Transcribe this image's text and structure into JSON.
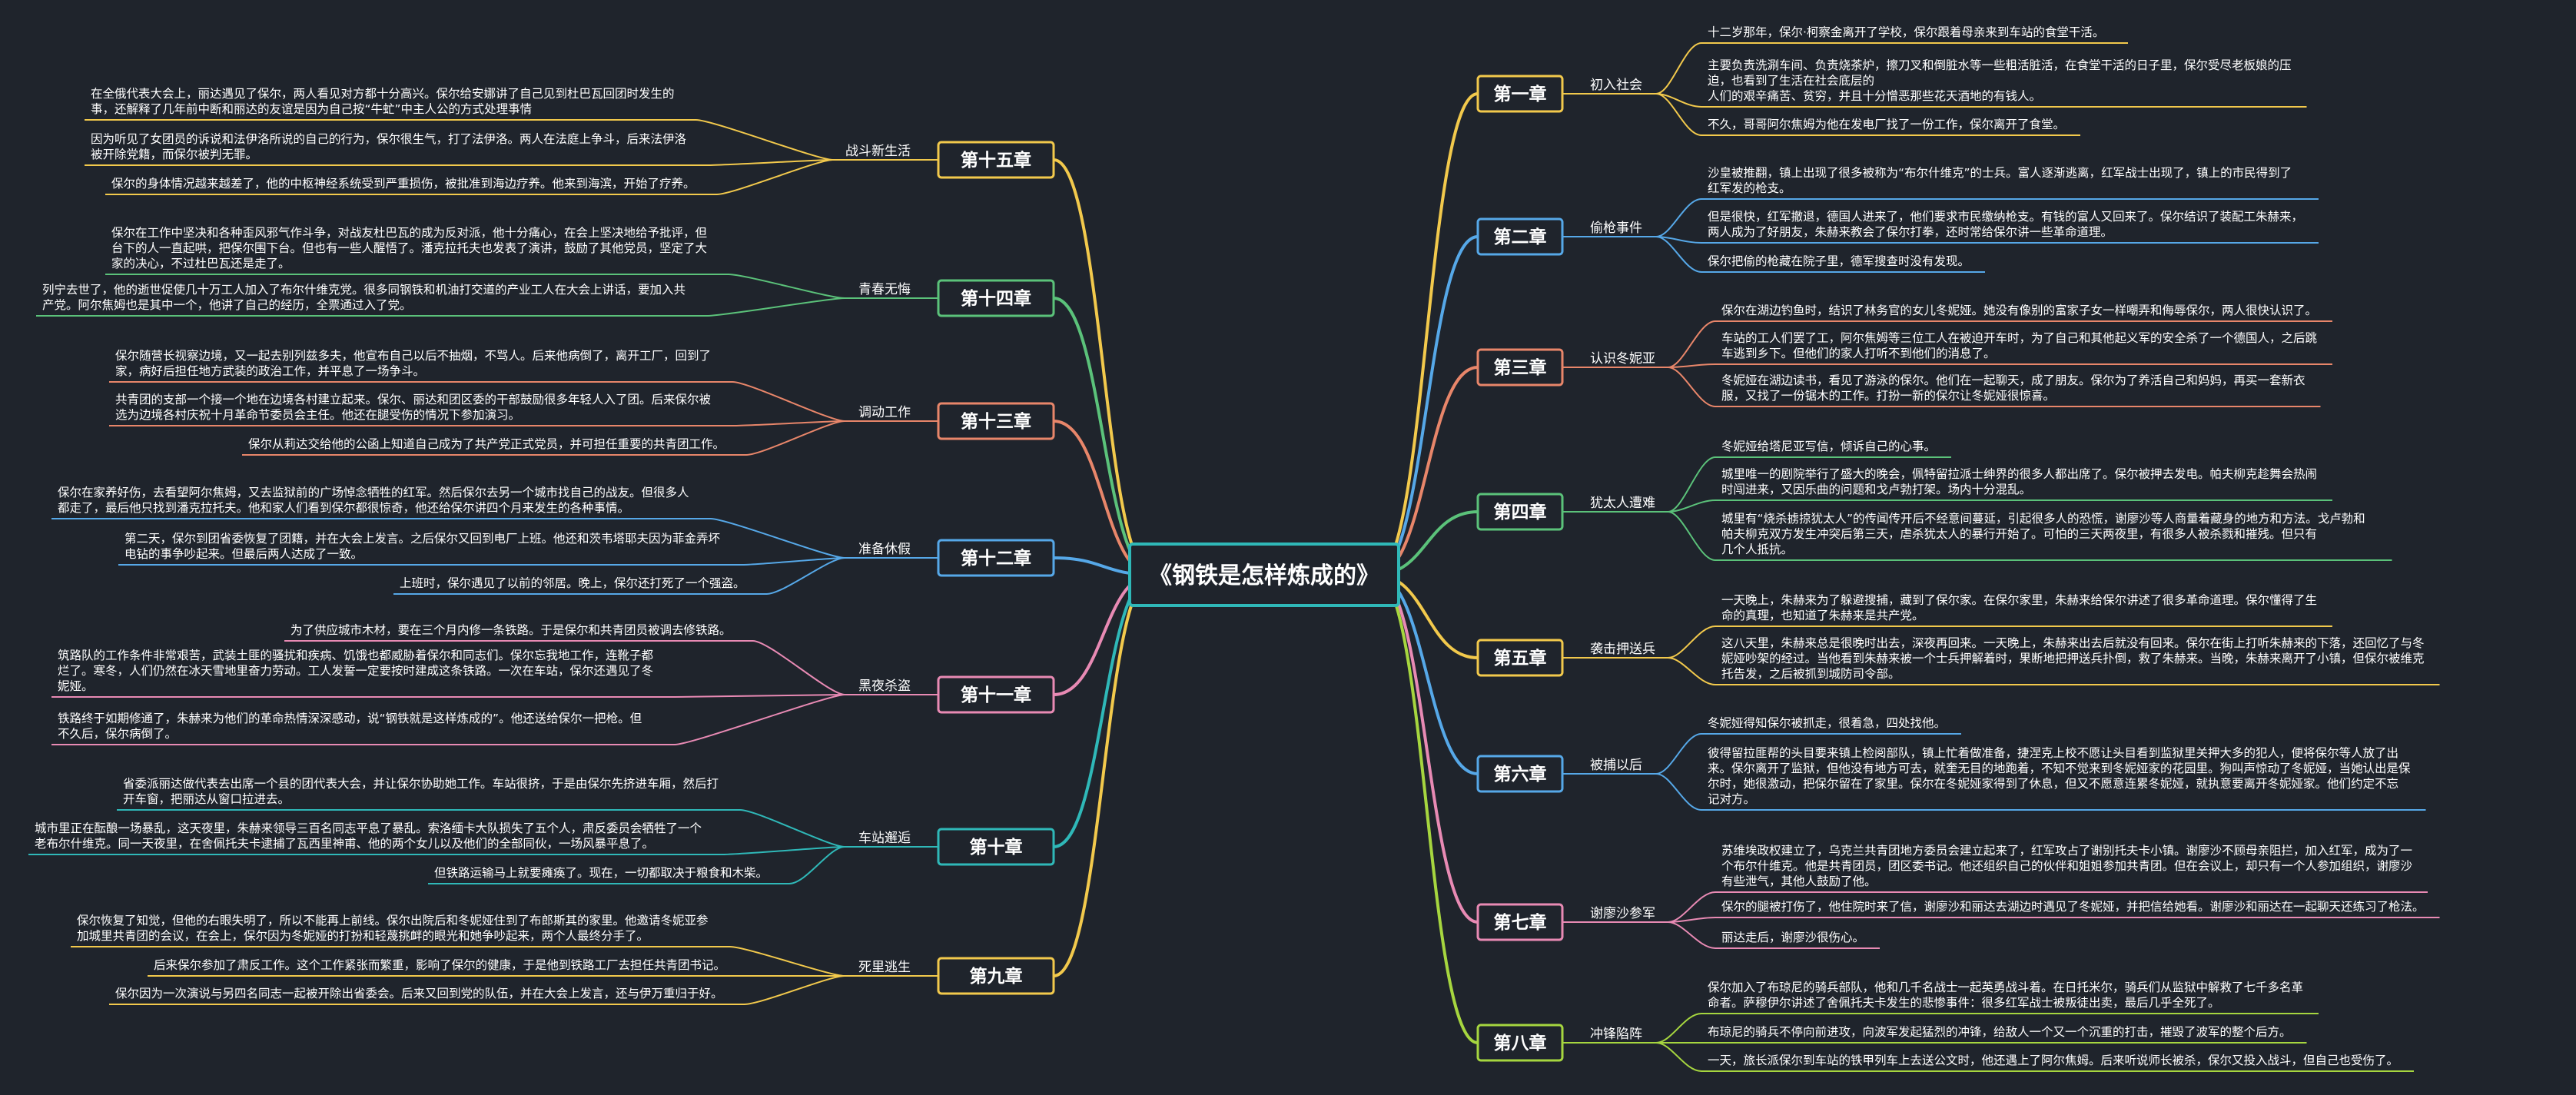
{
  "root": {
    "title": "《钢铁是怎样炼成的》",
    "color": "#2fb8b8"
  },
  "chapters": [
    {
      "label": "第一章",
      "sub": "初入社会",
      "color": "#f2c94c",
      "side": "right",
      "leaves": [
        [
          "十二岁那年，保尔·柯察金离开了学校，保尔跟着母亲来到车站的食堂干活。"
        ],
        [
          "主要负责洗涮车间、负责烧茶炉，擦刀叉和倒脏水等一些粗活脏活，在食堂干活的日子里，保尔受尽老板娘的压",
          "迫，也看到了生活在社会底层的",
          "人们的艰辛痛苦、贫穷，并且十分憎恶那些花天酒地的有钱人。"
        ],
        [
          "不久，哥哥阿尔焦姆为他在发电厂找了一份工作，保尔离开了食堂。"
        ]
      ]
    },
    {
      "label": "第二章",
      "sub": "偷枪事件",
      "color": "#56a8e8",
      "side": "right",
      "leaves": [
        [
          "沙皇被推翻，镇上出现了很多被称为“布尔什维克”的士兵。富人逐渐逃离，红军战士出现了，镇上的市民得到了",
          "红军发的枪支。"
        ],
        [
          "但是很快，红军撤退，德国人进来了，他们要求市民缴纳枪支。有钱的富人又回来了。保尔结识了装配工朱赫来，",
          "两人成为了好朋友，朱赫来教会了保尔打拳，还时常给保尔讲一些革命道理。"
        ],
        [
          "保尔把偷的枪藏在院子里，德军搜查时没有发现。"
        ]
      ]
    },
    {
      "label": "第三章",
      "sub": "认识冬妮亚",
      "color": "#e8866a",
      "side": "right",
      "leaves": [
        [
          "保尔在湖边钓鱼时，结识了林务官的女儿冬妮娅。她没有像别的富家子女一样嘲弄和侮辱保尔，两人很快认识了。"
        ],
        [
          "车站的工人们罢了工，阿尔焦姆等三位工人在被迫开车时，为了自己和其他起义军的安全杀了一个德国人，之后跳",
          "车逃到乡下。但他们的家人打听不到他们的消息了。"
        ],
        [
          "冬妮娅在湖边读书，看见了游泳的保尔。他们在一起聊天，成了朋友。保尔为了养活自己和妈妈，再买一套新衣",
          "服，又找了一份锯木的工作。打扮一新的保尔让冬妮娅很惊喜。"
        ]
      ]
    },
    {
      "label": "第四章",
      "sub": "犹太人遭难",
      "color": "#5bc27a",
      "side": "right",
      "leaves": [
        [
          "冬妮娅给塔尼亚写信，倾诉自己的心事。"
        ],
        [
          "城里唯一的剧院举行了盛大的晚会，佩特留拉派士绅界的很多人都出席了。保尔被押去发电。帕夫柳克趁舞会热闹",
          "时闯进来，又因乐曲的问题和戈卢勃打架。场内十分混乱。"
        ],
        [
          "城里有“烧杀掳掠犹太人”的传闻传开后不经意间蔓延，引起很多人的恐慌，谢廖沙等人商量着藏身的地方和方法。戈卢勃和",
          "帕夫柳克双方发生冲突后第三天，虐杀犹太人的暴行开始了。可怕的三天两夜里，有很多人被杀戮和摧残。但只有",
          "几个人抵抗。"
        ]
      ]
    },
    {
      "label": "第五章",
      "sub": "袭击押送兵",
      "color": "#f2c94c",
      "side": "right",
      "leaves": [
        [
          "一天晚上，朱赫来为了躲避搜捕，藏到了保尔家。在保尔家里，朱赫来给保尔讲述了很多革命道理。保尔懂得了生",
          "命的真理，也知道了朱赫来是共产党。"
        ],
        [
          "这八天里，朱赫来总是很晚时出去，深夜再回来。一天晚上，朱赫来出去后就没有回来。保尔在街上打听朱赫来的下落，还回忆了与冬",
          "妮娅吵架的经过。当他看到朱赫来被一个士兵押解着时，果断地把押送兵扑倒，救了朱赫来。当晚，朱赫来离开了小镇，但保尔被维克",
          "托告发，之后被抓到城防司令部。"
        ]
      ]
    },
    {
      "label": "第六章",
      "sub": "被捕以后",
      "color": "#56a8e8",
      "side": "right",
      "leaves": [
        [
          "冬妮娅得知保尔被抓走，很着急，四处找他。"
        ],
        [
          "彼得留拉匪帮的头目要来镇上检阅部队，镇上忙着做准备，捷涅克上校不愿让头目看到监狱里关押大多的犯人，便将保尔等人放了出",
          "来。保尔离开了监狱，但他没有地方可去，就奎无目的地跑着，不知不觉来到冬妮娅家的花园里。狗叫声惊动了冬妮娅，当她认出是保",
          "尔时，她很激动，把保尔留在了家里。保尔在冬妮娅家得到了休息，但又不愿意连累冬妮娅，就执意要离开冬妮娅家。他们约定不忘",
          "记对方。"
        ]
      ]
    },
    {
      "label": "第七章",
      "sub": "谢廖沙参军",
      "color": "#e88ab4",
      "side": "right",
      "leaves": [
        [
          "苏维埃政权建立了，乌克兰共青团地方委员会建立起来了，红军攻占了谢别托夫卡小镇。谢廖沙不顾母亲阻拦，加入红军，成为了一",
          "个布尔什维克。他是共青团员，团区委书记。他还组织自己的伙伴和姐姐参加共青团。但在会议上，却只有一个人参加组织，谢廖沙",
          "有些泄气，其他人鼓励了他。"
        ],
        [
          "保尔的腿被打伤了，他住院时来了信，谢廖沙和丽达去湖边时遇见了冬妮娅，并把信给她看。谢廖沙和丽达在一起聊天还练习了枪法。"
        ],
        [
          "丽达走后，谢廖沙很伤心。"
        ]
      ]
    },
    {
      "label": "第八章",
      "sub": "冲锋陷阵",
      "color": "#a6d63f",
      "side": "right",
      "leaves": [
        [
          "保尔加入了布琼尼的骑兵部队，他和几千名战士一起英勇战斗着。在日托米尔，骑兵们从监狱中解救了七千多名革",
          "命者。萨穆伊尔讲述了舍佩托夫卡发生的悲惨事件：很多红军战士被叛徒出卖，最后几乎全死了。"
        ],
        [
          "布琼尼的骑兵不停向前进攻，向波军发起猛烈的冲锋，给敌人一个又一个沉重的打击，摧毁了波军的整个后方。"
        ],
        [
          "一天，旅长派保尔到车站的铁甲列车上去送公文时，他还遇上了阿尔焦姆。后来听说师长被杀，保尔又投入战斗，但自己也受伤了。"
        ]
      ]
    },
    {
      "label": "第十五章",
      "sub": "战斗新生活",
      "color": "#f2c94c",
      "side": "left",
      "leaves": [
        [
          "在全俄代表大会上，丽达遇见了保尔，两人看见对方都十分高兴。保尔给安娜讲了自己见到杜巴瓦回团时发生的",
          "事，还解释了几年前中断和丽达的友谊是因为自己按“牛虻”中主人公的方式处理事情"
        ],
        [
          "因为听见了女团员的诉说和法伊洛所说的自己的行为，保尔很生气，打了法伊洛。两人在法庭上争斗，后来法伊洛",
          "被开除党籍，而保尔被判无罪。"
        ],
        [
          "保尔的身体情况越来越差了，他的中枢神经系统受到严重损伤，被批准到海边疗养。他来到海滨，开始了疗养。"
        ]
      ]
    },
    {
      "label": "第十四章",
      "sub": "青春无悔",
      "color": "#5bc27a",
      "side": "left",
      "leaves": [
        [
          "保尔在工作中坚决和各种歪风邪气作斗争，对战友杜巴瓦的成为反对派，他十分痛心，在会上坚决地给予批评，但",
          "台下的人一直起哄，把保尔围下台。但也有一些人醒悟了。潘克拉托夫也发表了演讲，鼓励了其他党员，坚定了大",
          "家的决心，不过杜巴瓦还是走了。"
        ],
        [
          "列宁去世了，他的逝世促使几十万工人加入了布尔什维克党。很多同钢铁和机油打交道的产业工人在大会上讲话，要加入共",
          "产党。阿尔焦姆也是其中一个，他讲了自己的经历，全票通过入了党。"
        ]
      ]
    },
    {
      "label": "第十三章",
      "sub": "调动工作",
      "color": "#e8866a",
      "side": "left",
      "leaves": [
        [
          "保尔随营长视察边境，又一起去别列兹多夫，他宣布自己以后不抽烟，不骂人。后来他病倒了，离开工厂，回到了",
          "家，病好后担任地方武装的政治工作，并平息了一场争斗。"
        ],
        [
          "共青团的支部一个接一个地在边境各村建立起来。保尔、丽达和团区委的干部鼓励很多年轻人入了团。后来保尔被",
          "选为边境各村庆祝十月革命节委员会主任。他还在腿受伤的情况下参加演习。"
        ],
        [
          "保尔从莉达交给他的公函上知道自己成为了共产党正式党员，并可担任重要的共青团工作。"
        ]
      ]
    },
    {
      "label": "第十二章",
      "sub": "准备休假",
      "color": "#56a8e8",
      "side": "left",
      "leaves": [
        [
          "保尔在家养好伤，去看望阿尔焦姆，又去监狱前的广场悼念牺牲的红军。然后保尔去另一个城市找自己的战友。但很多人",
          "都走了，最后他只找到潘克拉托夫。他和家人们看到保尔都很惊奇，他还给保尔讲四个月来发生的各种事情。"
        ],
        [
          "第二天，保尔到团省委恢复了团籍，并在大会上发言。之后保尔又回到电厂上班。他还和茨韦塔耶夫因为菲金弄坏",
          "电钻的事争吵起来。但最后两人达成了一致。"
        ],
        [
          "上班时，保尔遇见了以前的邻居。晚上，保尔还打死了一个强盗。"
        ]
      ]
    },
    {
      "label": "第十一章",
      "sub": "黑夜杀盗",
      "color": "#e88ab4",
      "side": "left",
      "leaves": [
        [
          "为了供应城市木材，要在三个月内修一条铁路。于是保尔和共青团员被调去修铁路。"
        ],
        [
          "筑路队的工作条件非常艰苦，武装土匪的骚扰和疾病、饥饿也都威胁着保尔和同志们。保尔忘我地工作，连靴子都",
          "烂了。寒冬，人们仍然在冰天雪地里奋力劳动。工人发誓一定要按时建成这条铁路。一次在车站，保尔还遇见了冬",
          "妮娅。"
        ],
        [
          "铁路终于如期修通了，朱赫来为他们的革命热情深深感动，说“钢铁就是这样炼成的”。他还送给保尔一把枪。但",
          "不久后，保尔病倒了。"
        ]
      ]
    },
    {
      "label": "第十章",
      "sub": "车站邂逅",
      "color": "#2fb8b8",
      "side": "left",
      "leaves": [
        [
          "省委派丽达做代表去出席一个县的团代表大会，并让保尔协助她工作。车站很挤，于是由保尔先挤进车厢，然后打",
          "开车窗，把丽达从窗口拉进去。"
        ],
        [
          "城市里正在酝酿一场暴乱，这天夜里，朱赫来领导三百名同志平息了暴乱。索洛缅卡大队损失了五个人，肃反委员会牺牲了一个",
          "老布尔什维克。同一天夜里，在舍佩托夫卡逮捕了瓦西里神甫、他的两个女儿以及他们的全部同伙，一场风暴平息了。"
        ],
        [
          "但铁路运输马上就要瘫痪了。现在，一切都取决于粮食和木柴。"
        ]
      ]
    },
    {
      "label": "第九章",
      "sub": "死里逃生",
      "color": "#f2c94c",
      "side": "left",
      "leaves": [
        [
          "保尔恢复了知觉，但他的右眼失明了，所以不能再上前线。保尔出院后和冬妮娅住到了布郎斯其的家里。他邀请冬妮亚参",
          "加城里共青团的会议，在会上，保尔因为冬妮娅的打扮和轻蔑挑衅的眼光和她争吵起来，两个人最终分手了。"
        ],
        [
          "后来保尔参加了肃反工作。这个工作紧张而繁重，影响了保尔的健康，于是他到铁路工厂去担任共青团书记。"
        ],
        [
          "保尔因为一次演说与另四名同志一起被开除出省委会。后来又回到党的队伍，并在大会上发言，还与伊万重归于好。"
        ]
      ]
    }
  ]
}
